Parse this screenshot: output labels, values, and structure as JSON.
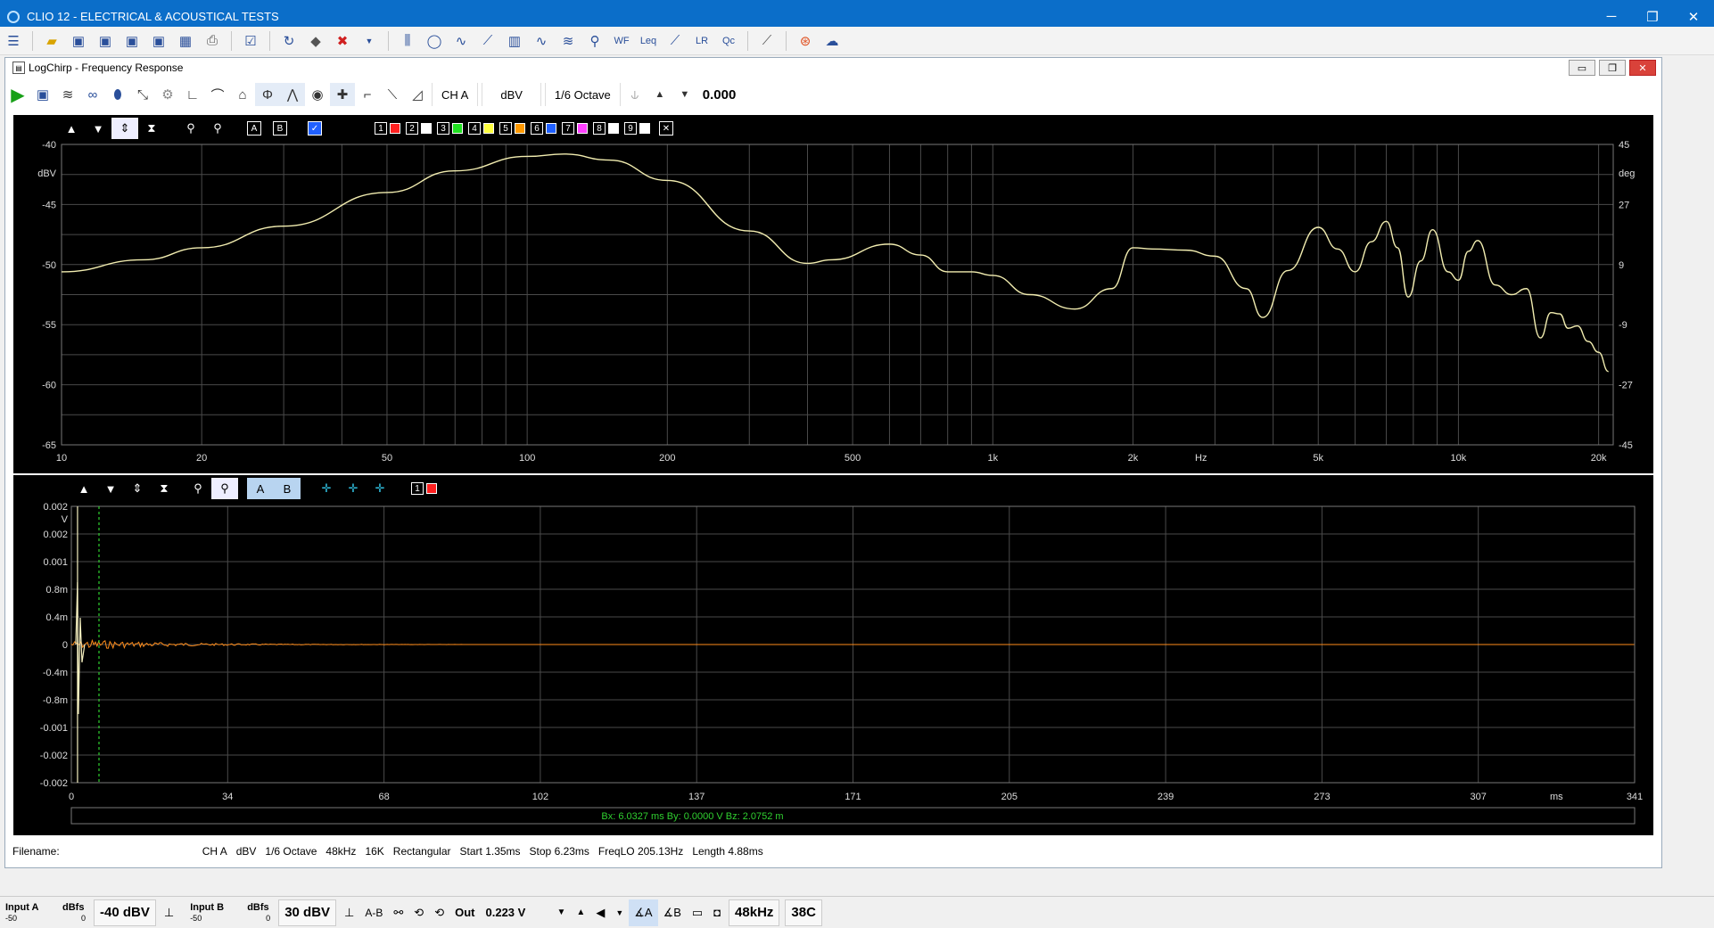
{
  "window": {
    "title": "CLIO 12 - ELECTRICAL & ACOUSTICAL TESTS",
    "min": "─",
    "max": "❐",
    "close": "✕"
  },
  "child": {
    "title": "LogChirp - Frequency Response",
    "channel": "CH A",
    "unit": "dBV",
    "smoothing": "1/6 Octave",
    "value": "0.000"
  },
  "freq_chart": {
    "y_left_unit": "dBV",
    "y_right_unit": "deg",
    "x_unit": "Hz",
    "y_left_ticks": [
      "-40",
      "-45",
      "-50",
      "-55",
      "-60",
      "-65"
    ],
    "y_right_ticks": [
      "45",
      "27",
      "9",
      "-9",
      "-27",
      "-45"
    ],
    "x_ticks": [
      {
        "f": 10,
        "label": "10"
      },
      {
        "f": 20,
        "label": "20"
      },
      {
        "f": 50,
        "label": "50"
      },
      {
        "f": 100,
        "label": "100"
      },
      {
        "f": 200,
        "label": "200"
      },
      {
        "f": 500,
        "label": "500"
      },
      {
        "f": 1000,
        "label": "1k"
      },
      {
        "f": 2000,
        "label": "2k"
      },
      {
        "f": 5000,
        "label": "5k"
      },
      {
        "f": 10000,
        "label": "10k"
      },
      {
        "f": 20000,
        "label": "20k"
      }
    ],
    "memories": [
      "1",
      "2",
      "3",
      "4",
      "5",
      "6",
      "7",
      "8",
      "9"
    ],
    "memory_colors": [
      "#ff2020",
      "#ffffff",
      "#20e020",
      "#ffff40",
      "#ff9900",
      "#2060ff",
      "#ff40ff",
      "#ffffff",
      "#ffffff"
    ],
    "curve": [
      [
        10,
        -50.6
      ],
      [
        15,
        -49.6
      ],
      [
        20,
        -48.6
      ],
      [
        30,
        -46.8
      ],
      [
        50,
        -44.0
      ],
      [
        70,
        -42.2
      ],
      [
        100,
        -41.0
      ],
      [
        120,
        -40.8
      ],
      [
        150,
        -41.3
      ],
      [
        200,
        -43.0
      ],
      [
        300,
        -47.2
      ],
      [
        400,
        -49.9
      ],
      [
        450,
        -49.6
      ],
      [
        600,
        -48.3
      ],
      [
        700,
        -49.2
      ],
      [
        800,
        -50.6
      ],
      [
        900,
        -50.6
      ],
      [
        1000,
        -50.9
      ],
      [
        1200,
        -52.5
      ],
      [
        1500,
        -53.7
      ],
      [
        1800,
        -52.0
      ],
      [
        2000,
        -48.6
      ],
      [
        2200,
        -48.7
      ],
      [
        2600,
        -48.8
      ],
      [
        3000,
        -49.3
      ],
      [
        3500,
        -52.0
      ],
      [
        3800,
        -54.4
      ],
      [
        4300,
        -50.5
      ],
      [
        5000,
        -46.9
      ],
      [
        5500,
        -48.7
      ],
      [
        6000,
        -50.6
      ],
      [
        6500,
        -48.1
      ],
      [
        7000,
        -46.4
      ],
      [
        7400,
        -48.6
      ],
      [
        7800,
        -52.7
      ],
      [
        8300,
        -49.7
      ],
      [
        8800,
        -47.1
      ],
      [
        9500,
        -50.6
      ],
      [
        10000,
        -51.3
      ],
      [
        10500,
        -48.9
      ],
      [
        11000,
        -48.0
      ],
      [
        12000,
        -51.7
      ],
      [
        13000,
        -52.5
      ],
      [
        14000,
        -52.0
      ],
      [
        15000,
        -56.1
      ],
      [
        15800,
        -54.0
      ],
      [
        16500,
        -54.1
      ],
      [
        17200,
        -55.3
      ],
      [
        18000,
        -55.1
      ],
      [
        19000,
        -56.4
      ],
      [
        20000,
        -57.3
      ],
      [
        21000,
        -58.9
      ]
    ]
  },
  "time_chart": {
    "y_unit": "V",
    "x_unit": "ms",
    "y_ticks": [
      "0.002",
      "0.002",
      "0.001",
      "0.8m",
      "0.4m",
      "0",
      "-0.4m",
      "-0.8m",
      "-0.001",
      "-0.002",
      "-0.002"
    ],
    "x_ticks": [
      "0",
      "34",
      "68",
      "102",
      "137",
      "171",
      "205",
      "239",
      "273",
      "307",
      "341"
    ],
    "x_max": 341,
    "cursor_ms": 6.03,
    "readout": "Bx: 6.0327 ms   By: 0.0000 V   Bz: 2.0752 m"
  },
  "status": {
    "filename_label": "Filename:",
    "fields": [
      "CH A",
      "dBV",
      "1/6 Octave",
      "48kHz",
      "16K",
      "Rectangular",
      "Start 1.35ms",
      "Stop 6.23ms",
      "FreqLO 205.13Hz",
      "Length 4.88ms"
    ]
  },
  "bottom": {
    "input_a": "Input A",
    "dbfs_a": "dBfs",
    "a_min": "-50",
    "a_zero": "0",
    "a_level": "-40 dBV",
    "input_b": "Input B",
    "dbfs_b": "dBfs",
    "b_min": "-50",
    "b_zero": "0",
    "b_level": "30 dBV",
    "ab": "A-B",
    "out": "Out",
    "out_level": "0.223 V",
    "rate": "48kHz",
    "temp": "38C"
  }
}
